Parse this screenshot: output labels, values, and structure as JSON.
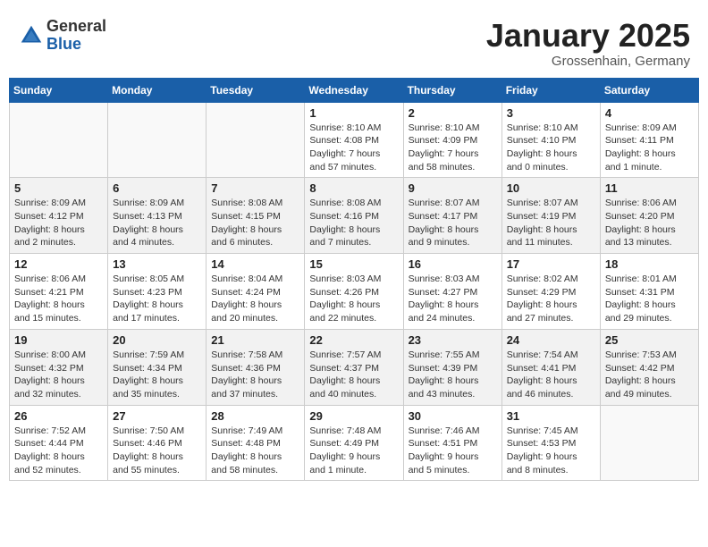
{
  "header": {
    "logo_general": "General",
    "logo_blue": "Blue",
    "month_title": "January 2025",
    "location": "Grossenhain, Germany"
  },
  "weekdays": [
    "Sunday",
    "Monday",
    "Tuesday",
    "Wednesday",
    "Thursday",
    "Friday",
    "Saturday"
  ],
  "weeks": [
    [
      {
        "day": "",
        "info": ""
      },
      {
        "day": "",
        "info": ""
      },
      {
        "day": "",
        "info": ""
      },
      {
        "day": "1",
        "info": "Sunrise: 8:10 AM\nSunset: 4:08 PM\nDaylight: 7 hours and 57 minutes."
      },
      {
        "day": "2",
        "info": "Sunrise: 8:10 AM\nSunset: 4:09 PM\nDaylight: 7 hours and 58 minutes."
      },
      {
        "day": "3",
        "info": "Sunrise: 8:10 AM\nSunset: 4:10 PM\nDaylight: 8 hours and 0 minutes."
      },
      {
        "day": "4",
        "info": "Sunrise: 8:09 AM\nSunset: 4:11 PM\nDaylight: 8 hours and 1 minute."
      }
    ],
    [
      {
        "day": "5",
        "info": "Sunrise: 8:09 AM\nSunset: 4:12 PM\nDaylight: 8 hours and 2 minutes."
      },
      {
        "day": "6",
        "info": "Sunrise: 8:09 AM\nSunset: 4:13 PM\nDaylight: 8 hours and 4 minutes."
      },
      {
        "day": "7",
        "info": "Sunrise: 8:08 AM\nSunset: 4:15 PM\nDaylight: 8 hours and 6 minutes."
      },
      {
        "day": "8",
        "info": "Sunrise: 8:08 AM\nSunset: 4:16 PM\nDaylight: 8 hours and 7 minutes."
      },
      {
        "day": "9",
        "info": "Sunrise: 8:07 AM\nSunset: 4:17 PM\nDaylight: 8 hours and 9 minutes."
      },
      {
        "day": "10",
        "info": "Sunrise: 8:07 AM\nSunset: 4:19 PM\nDaylight: 8 hours and 11 minutes."
      },
      {
        "day": "11",
        "info": "Sunrise: 8:06 AM\nSunset: 4:20 PM\nDaylight: 8 hours and 13 minutes."
      }
    ],
    [
      {
        "day": "12",
        "info": "Sunrise: 8:06 AM\nSunset: 4:21 PM\nDaylight: 8 hours and 15 minutes."
      },
      {
        "day": "13",
        "info": "Sunrise: 8:05 AM\nSunset: 4:23 PM\nDaylight: 8 hours and 17 minutes."
      },
      {
        "day": "14",
        "info": "Sunrise: 8:04 AM\nSunset: 4:24 PM\nDaylight: 8 hours and 20 minutes."
      },
      {
        "day": "15",
        "info": "Sunrise: 8:03 AM\nSunset: 4:26 PM\nDaylight: 8 hours and 22 minutes."
      },
      {
        "day": "16",
        "info": "Sunrise: 8:03 AM\nSunset: 4:27 PM\nDaylight: 8 hours and 24 minutes."
      },
      {
        "day": "17",
        "info": "Sunrise: 8:02 AM\nSunset: 4:29 PM\nDaylight: 8 hours and 27 minutes."
      },
      {
        "day": "18",
        "info": "Sunrise: 8:01 AM\nSunset: 4:31 PM\nDaylight: 8 hours and 29 minutes."
      }
    ],
    [
      {
        "day": "19",
        "info": "Sunrise: 8:00 AM\nSunset: 4:32 PM\nDaylight: 8 hours and 32 minutes."
      },
      {
        "day": "20",
        "info": "Sunrise: 7:59 AM\nSunset: 4:34 PM\nDaylight: 8 hours and 35 minutes."
      },
      {
        "day": "21",
        "info": "Sunrise: 7:58 AM\nSunset: 4:36 PM\nDaylight: 8 hours and 37 minutes."
      },
      {
        "day": "22",
        "info": "Sunrise: 7:57 AM\nSunset: 4:37 PM\nDaylight: 8 hours and 40 minutes."
      },
      {
        "day": "23",
        "info": "Sunrise: 7:55 AM\nSunset: 4:39 PM\nDaylight: 8 hours and 43 minutes."
      },
      {
        "day": "24",
        "info": "Sunrise: 7:54 AM\nSunset: 4:41 PM\nDaylight: 8 hours and 46 minutes."
      },
      {
        "day": "25",
        "info": "Sunrise: 7:53 AM\nSunset: 4:42 PM\nDaylight: 8 hours and 49 minutes."
      }
    ],
    [
      {
        "day": "26",
        "info": "Sunrise: 7:52 AM\nSunset: 4:44 PM\nDaylight: 8 hours and 52 minutes."
      },
      {
        "day": "27",
        "info": "Sunrise: 7:50 AM\nSunset: 4:46 PM\nDaylight: 8 hours and 55 minutes."
      },
      {
        "day": "28",
        "info": "Sunrise: 7:49 AM\nSunset: 4:48 PM\nDaylight: 8 hours and 58 minutes."
      },
      {
        "day": "29",
        "info": "Sunrise: 7:48 AM\nSunset: 4:49 PM\nDaylight: 9 hours and 1 minute."
      },
      {
        "day": "30",
        "info": "Sunrise: 7:46 AM\nSunset: 4:51 PM\nDaylight: 9 hours and 5 minutes."
      },
      {
        "day": "31",
        "info": "Sunrise: 7:45 AM\nSunset: 4:53 PM\nDaylight: 9 hours and 8 minutes."
      },
      {
        "day": "",
        "info": ""
      }
    ]
  ]
}
